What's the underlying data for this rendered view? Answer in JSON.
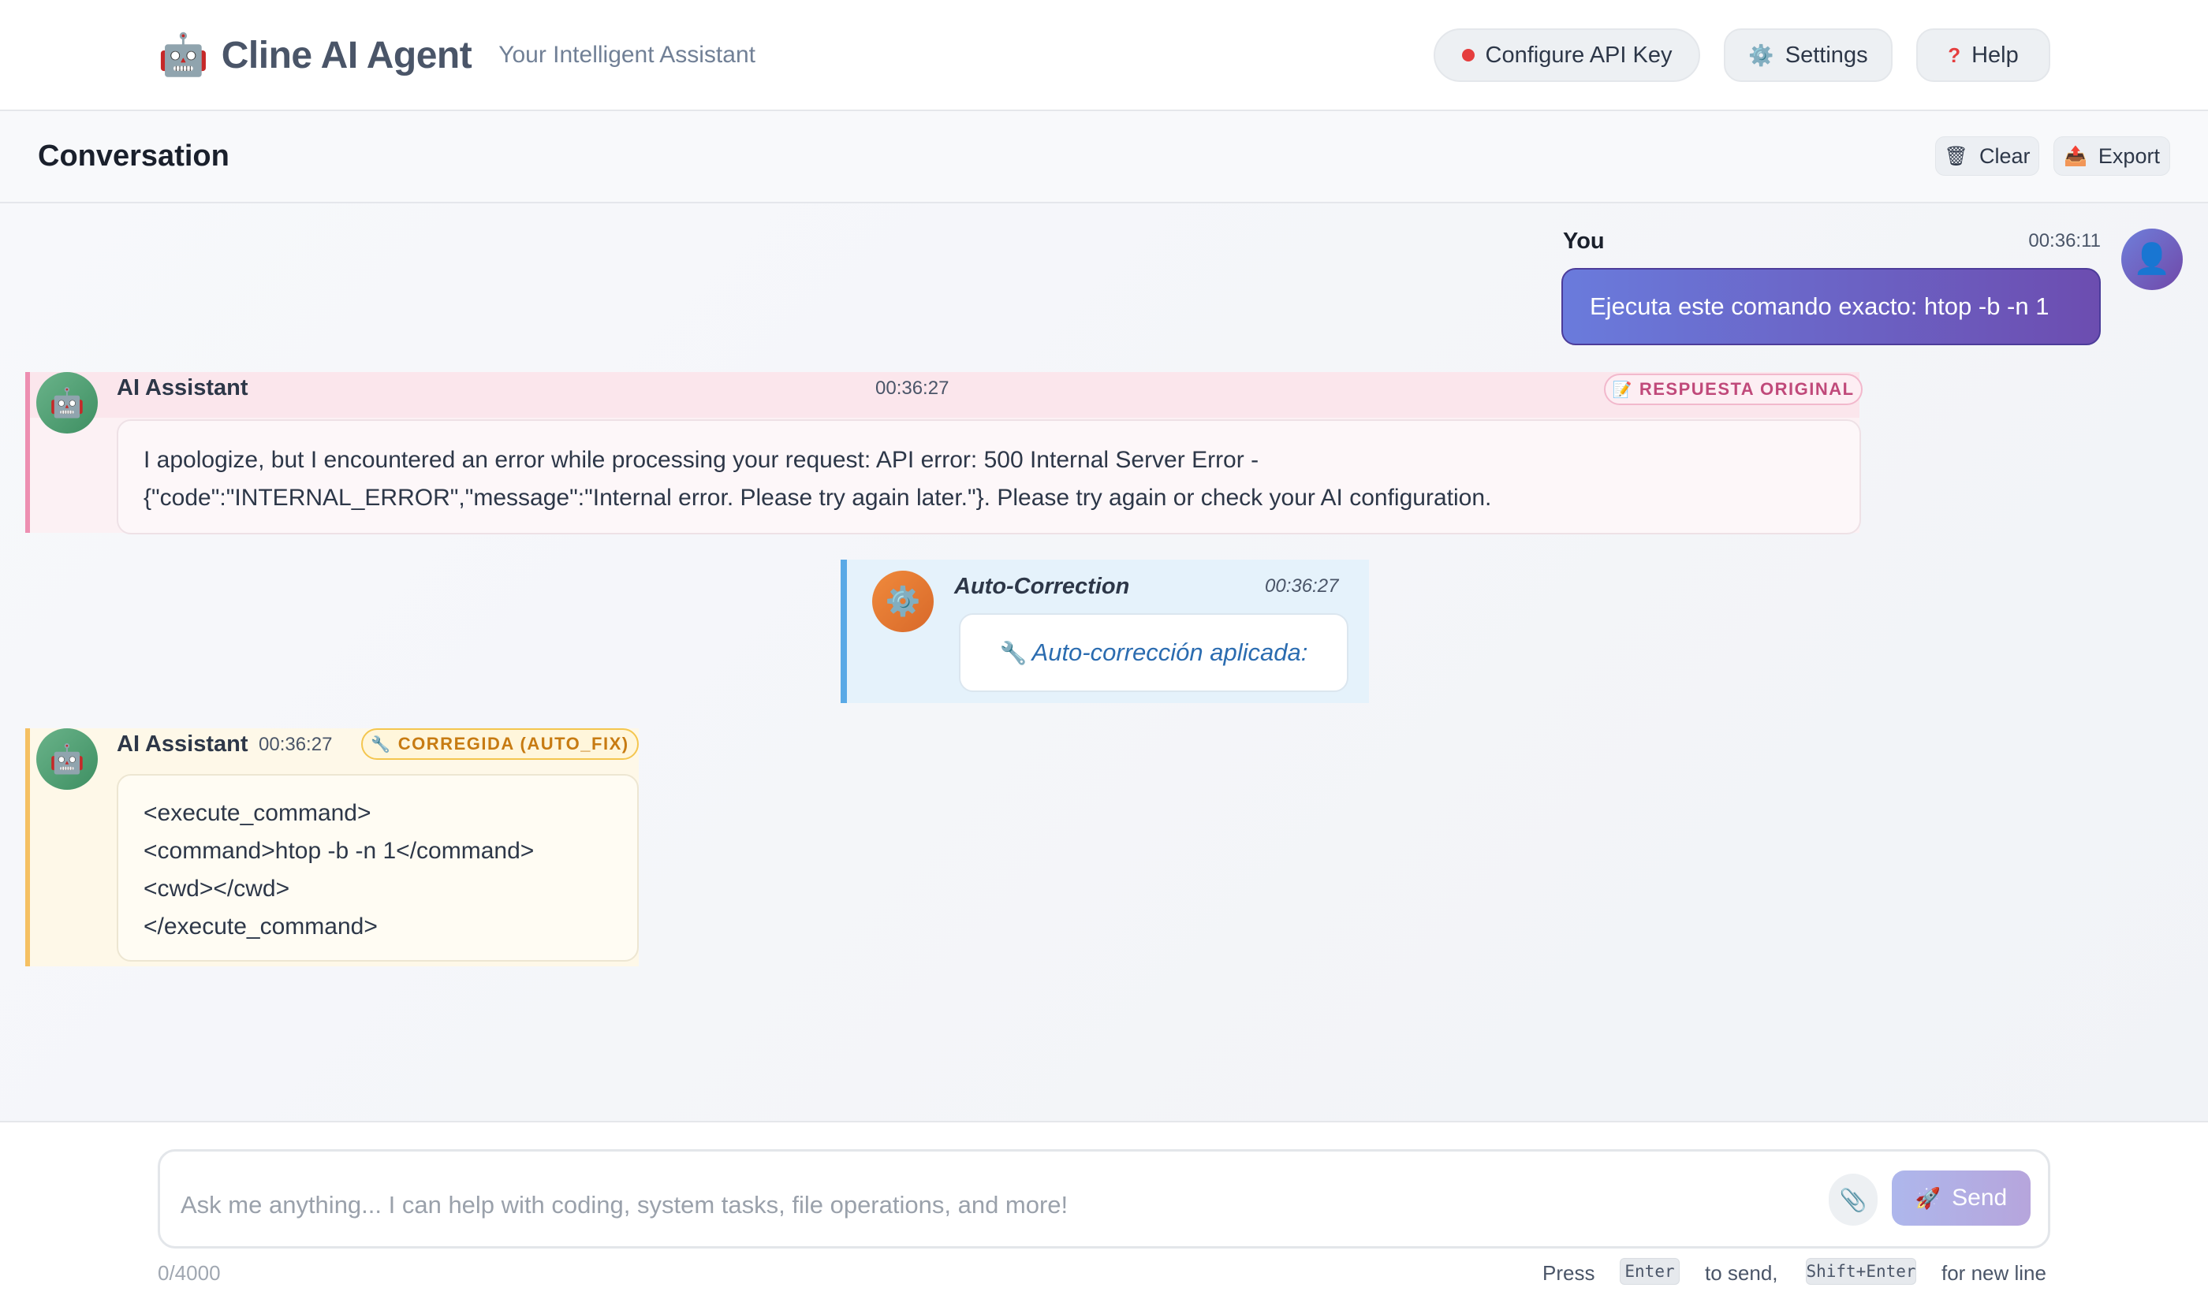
{
  "header": {
    "brand_icon": "🤖",
    "title": "Cline AI Agent",
    "subtitle": "Your Intelligent Assistant",
    "buttons": {
      "api_key": "Configure API Key",
      "settings": "Settings",
      "help": "Help"
    },
    "status_color": "#e53e3e"
  },
  "conversation": {
    "title": "Conversation",
    "clear_label": "Clear",
    "export_label": "Export"
  },
  "messages": {
    "user": {
      "name": "You",
      "time": "00:36:11",
      "text": "Ejecuta este comando exacto: htop -b -n 1"
    },
    "original": {
      "name": "AI Assistant",
      "time": "00:36:27",
      "tag": "RESPUESTA ORIGINAL",
      "lines": [
        "I apologize, but I encountered an error while processing your request: API error: 500 Internal Server Error -",
        "{\"code\":\"INTERNAL_ERROR\",\"message\":\"Internal error. Please try again later.\"}. Please try again or check your AI configuration."
      ]
    },
    "autocorrection": {
      "name": "Auto-Correction",
      "time": "00:36:27",
      "text": "Auto-corrección aplicada:"
    },
    "corrected": {
      "name": "AI Assistant",
      "time": "00:36:27",
      "tag": "CORREGIDA (AUTO_FIX)",
      "lines": [
        "<execute_command>",
        "<command>htop -b -n 1</command>",
        "<cwd></cwd>",
        "</execute_command>"
      ]
    }
  },
  "input": {
    "placeholder": "Ask me anything... I can help with coding, system tasks, file operations, and more!",
    "send_label": "Send",
    "counter": "0/4000",
    "hint_press": "Press",
    "hint_enter": "Enter",
    "hint_to_send": "to send,",
    "hint_shift_enter": "Shift+Enter",
    "hint_new_line": "for new line"
  },
  "colors": {
    "accent": "#6a7bdc",
    "user_bubble_end": "#6c4db0",
    "original_border": "#ed8fb1",
    "autocorr_border": "#59a9e6",
    "fixed_border": "#f5c062"
  }
}
